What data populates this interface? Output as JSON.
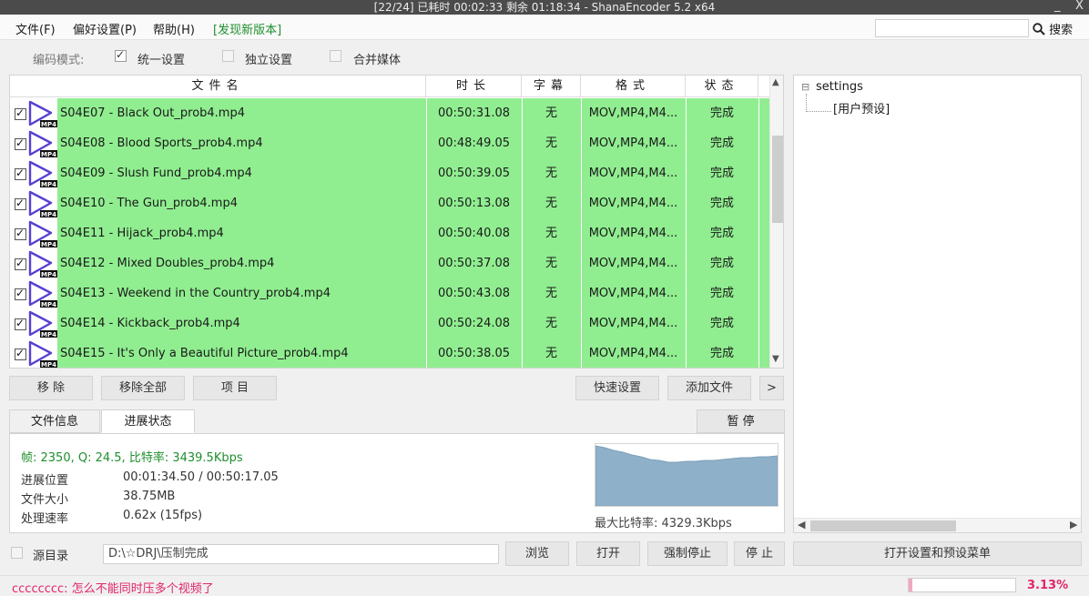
{
  "window": {
    "title": "[22/24] 已耗时 00:02:33  剩余 01:18:34 - ShanaEncoder 5.2  x64",
    "minimize": "_",
    "close": "X"
  },
  "menu": {
    "file": "文件(F)",
    "prefs": "偏好设置(P)",
    "help": "帮助(H)",
    "new_version": "[发现新版本]",
    "search_label": "搜索",
    "search_value": ""
  },
  "mode": {
    "label": "编码模式:",
    "unified": "统一设置",
    "unified_checked": true,
    "individual": "独立设置",
    "individual_checked": false,
    "merge": "合并媒体",
    "merge_checked": false
  },
  "table": {
    "headers": [
      "文件名",
      "时长",
      "字幕",
      "格式",
      "状态"
    ],
    "rows": [
      {
        "name": "S04E07 - Black Out_prob4.mp4",
        "duration": "00:50:31.08",
        "subtitle": "无",
        "format": "MOV,MP4,M4...",
        "status": "完成",
        "checked": true
      },
      {
        "name": "S04E08 - Blood Sports_prob4.mp4",
        "duration": "00:48:49.05",
        "subtitle": "无",
        "format": "MOV,MP4,M4...",
        "status": "完成",
        "checked": true
      },
      {
        "name": "S04E09 - Slush Fund_prob4.mp4",
        "duration": "00:50:39.05",
        "subtitle": "无",
        "format": "MOV,MP4,M4...",
        "status": "完成",
        "checked": true
      },
      {
        "name": "S04E10 - The Gun_prob4.mp4",
        "duration": "00:50:13.08",
        "subtitle": "无",
        "format": "MOV,MP4,M4...",
        "status": "完成",
        "checked": true
      },
      {
        "name": "S04E11 - Hijack_prob4.mp4",
        "duration": "00:50:40.08",
        "subtitle": "无",
        "format": "MOV,MP4,M4...",
        "status": "完成",
        "checked": true
      },
      {
        "name": "S04E12 - Mixed Doubles_prob4.mp4",
        "duration": "00:50:37.08",
        "subtitle": "无",
        "format": "MOV,MP4,M4...",
        "status": "完成",
        "checked": true
      },
      {
        "name": "S04E13 - Weekend in the Country_prob4.mp4",
        "duration": "00:50:43.08",
        "subtitle": "无",
        "format": "MOV,MP4,M4...",
        "status": "完成",
        "checked": true
      },
      {
        "name": "S04E14 - Kickback_prob4.mp4",
        "duration": "00:50:24.08",
        "subtitle": "无",
        "format": "MOV,MP4,M4...",
        "status": "完成",
        "checked": true
      },
      {
        "name": "S04E15 - It's Only a Beautiful Picture_prob4.mp4",
        "duration": "00:50:38.05",
        "subtitle": "无",
        "format": "MOV,MP4,M4...",
        "status": "完成",
        "checked": true
      }
    ],
    "row_color": "#90ee90",
    "file_icon": "play-icon",
    "file_badge": "MP4"
  },
  "buttons": {
    "remove": "移 除",
    "remove_all": "移除全部",
    "items": "项 目",
    "quick_settings": "快速设置",
    "add_file": "添加文件",
    "more": ">"
  },
  "tabs": {
    "file_info": "文件信息",
    "progress": "进展状态",
    "pause": "暂 停"
  },
  "progress": {
    "stats": "帧: 2350, Q: 24.5, 比特率: 3439.5Kbps",
    "position_label": "进展位置",
    "position_value": "00:01:34.50 / 00:50:17.05",
    "size_label": "文件大小",
    "size_value": "38.75MB",
    "speed_label": "处理速率",
    "speed_value": "0.62x (15fps)",
    "max_bitrate": "最大比特率: 4329.3Kbps",
    "graph_color": "#8fb0c9"
  },
  "tree": {
    "root": "settings",
    "child": "[用户预设]",
    "expander": "⊟"
  },
  "bottom": {
    "source_dir_label": "源目录",
    "source_dir_checked": false,
    "output_dir": "D:\\☆DRJ\\压制完成",
    "browse": "浏览",
    "open": "打开",
    "force_stop": "强制停止",
    "stop": "停 止",
    "open_settings": "打开设置和预设菜单"
  },
  "status": {
    "message": "cccccccc: 怎么不能同时压多个视频了",
    "percent_text": "3.13%",
    "percent": 3.13,
    "accent": "#e2246a"
  }
}
